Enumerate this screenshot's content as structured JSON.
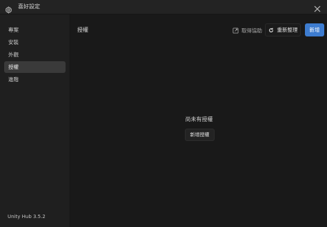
{
  "window": {
    "title": "喜好設定"
  },
  "sidebar": {
    "items": [
      {
        "label": "專案",
        "active": false
      },
      {
        "label": "安裝",
        "active": false
      },
      {
        "label": "外觀",
        "active": false
      },
      {
        "label": "授權",
        "active": true
      },
      {
        "label": "進階",
        "active": false
      }
    ],
    "version": "Unity Hub 3.5.2"
  },
  "main": {
    "title": "授權",
    "help_label": "取得協助",
    "refresh_label": "重新整理",
    "add_label": "新增",
    "empty_message": "尚未有授權",
    "empty_add_label": "新增授權"
  },
  "colors": {
    "accent": "#3d7cd0",
    "background": "#191919",
    "sidebar": "#1f1f1f",
    "active_item": "#3a3a3a"
  },
  "icons": {
    "title": "gear-icon",
    "close": "close-icon",
    "help": "external-link-icon",
    "refresh": "refresh-icon"
  }
}
